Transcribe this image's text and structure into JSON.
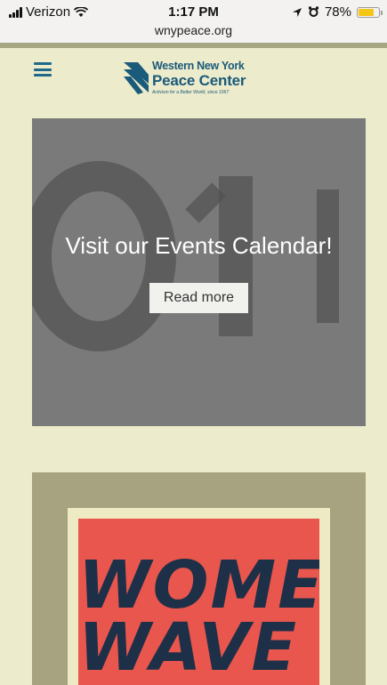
{
  "status_bar": {
    "carrier": "Verizon",
    "time": "1:17 PM",
    "battery_percent": "78%",
    "battery_level": 0.78,
    "battery_color": "#f5c518",
    "icons": [
      "signal-icon",
      "wifi-icon",
      "location-icon",
      "alarm-icon",
      "battery-icon"
    ]
  },
  "browser": {
    "url": "wnypeace.org"
  },
  "header": {
    "menu_icon": "hamburger-menu-icon",
    "logo": {
      "line1": "Western New York",
      "line2": "Peace Center",
      "tagline": "Activism for a Better World, since 1967"
    }
  },
  "slide": {
    "title": "Visit our Events Calendar!",
    "button_label": "Read more"
  },
  "card2": {
    "poster_lines": [
      "WOMEN",
      "WAVE"
    ]
  },
  "colors": {
    "page_bg": "#ecebcb",
    "brand": "#1a5a7a",
    "slide_bg": "#7a7a7a",
    "poster_red": "#e9564e"
  }
}
